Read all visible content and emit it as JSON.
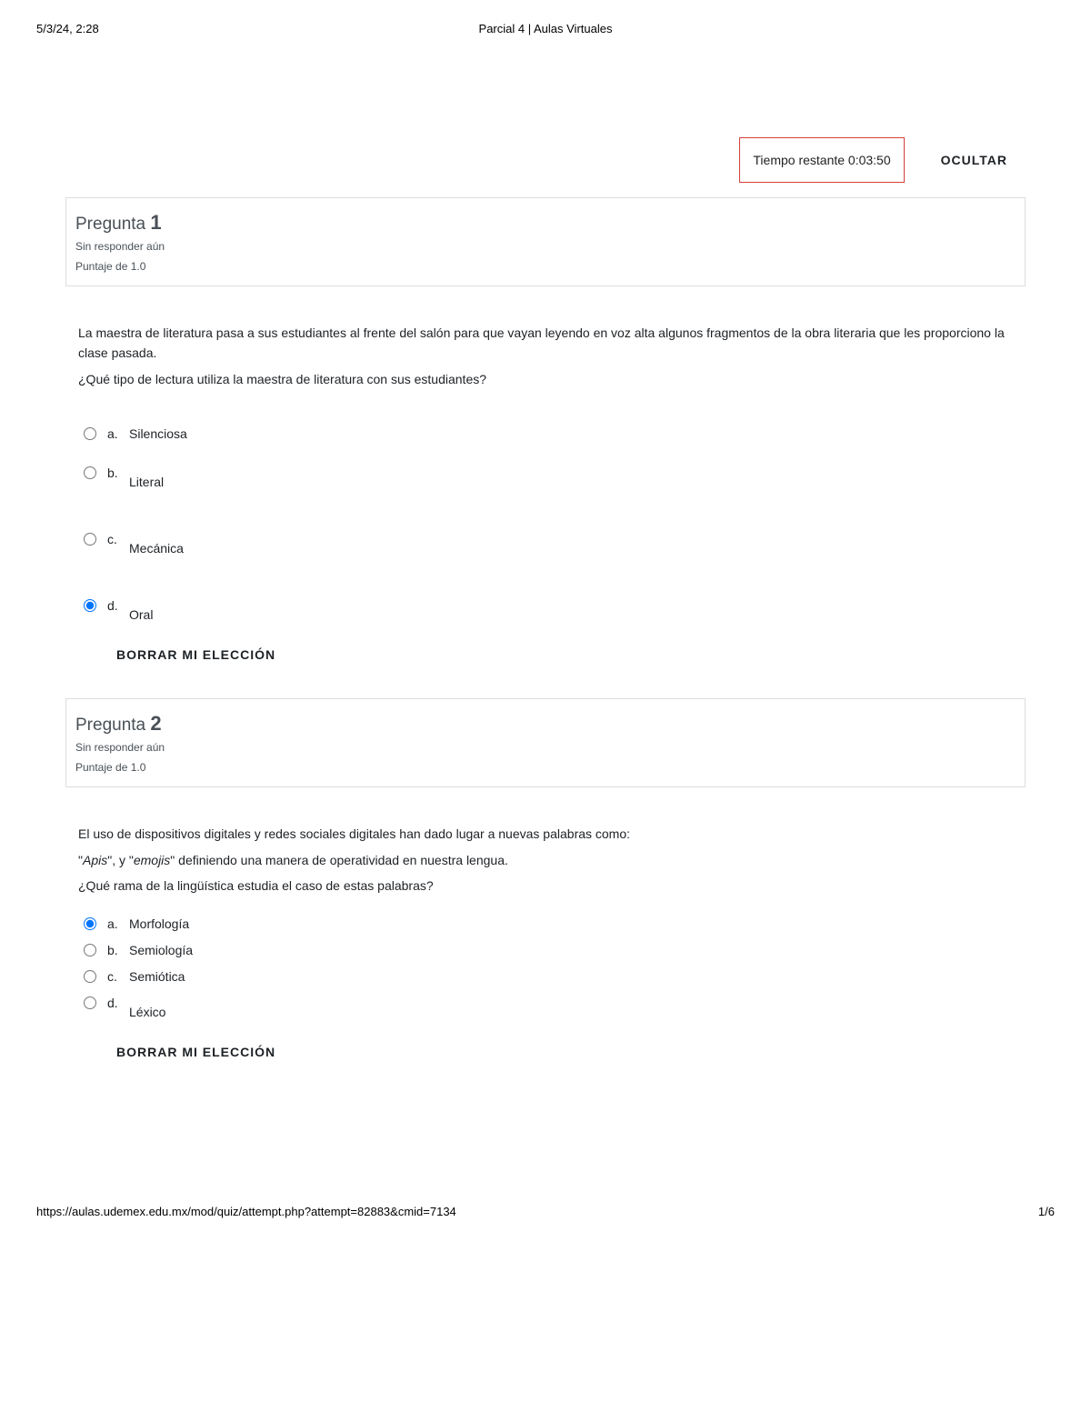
{
  "print": {
    "date": "5/3/24, 2:28",
    "title": "Parcial 4 | Aulas Virtuales",
    "url": "https://aulas.udemex.edu.mx/mod/quiz/attempt.php?attempt=82883&cmid=7134",
    "page": "1/6"
  },
  "timer": {
    "label_prefix": "Tiempo restante ",
    "value": "0:03:50"
  },
  "hide_label": "OCULTAR",
  "clear_label": "BORRAR MI ELECCIÓN",
  "q_prefix": "Pregunta ",
  "questions": [
    {
      "number": "1",
      "status": "Sin responder aún",
      "points": "Puntaje de 1.0",
      "text_lines": [
        "La maestra de literatura pasa a sus estudiantes al frente del salón para que vayan leyendo en voz alta algunos fragmentos de la obra literaria que les proporciono la clase pasada.",
        "¿Qué tipo de lectura utiliza la maestra de literatura con sus estudiantes?"
      ],
      "options": [
        {
          "letter": "a.",
          "label": "Silenciosa",
          "selected": false,
          "offset": false
        },
        {
          "letter": "b.",
          "label": "Literal",
          "selected": false,
          "offset": true
        },
        {
          "letter": "c.",
          "label": "Mecánica",
          "selected": false,
          "offset": true
        },
        {
          "letter": "d.",
          "label": "Oral",
          "selected": true,
          "offset": true
        }
      ],
      "spaced": true
    },
    {
      "number": "2",
      "status": "Sin responder aún",
      "points": "Puntaje de 1.0",
      "text_html": "El uso de dispositivos digitales y redes sociales digitales han dado lugar a nuevas palabras como:|\"<em>Apis</em>\", y \"<em>emojis</em>\" definiendo una manera de operatividad en nuestra lengua.|¿Qué rama de la lingüística estudia el caso de estas palabras?",
      "options": [
        {
          "letter": "a.",
          "label": "Morfología",
          "selected": true,
          "offset": false
        },
        {
          "letter": "b.",
          "label": "Semiología",
          "selected": false,
          "offset": false
        },
        {
          "letter": "c.",
          "label": "Semiótica",
          "selected": false,
          "offset": false
        },
        {
          "letter": "d.",
          "label": "Léxico",
          "selected": false,
          "offset": true
        }
      ],
      "spaced": false
    }
  ]
}
